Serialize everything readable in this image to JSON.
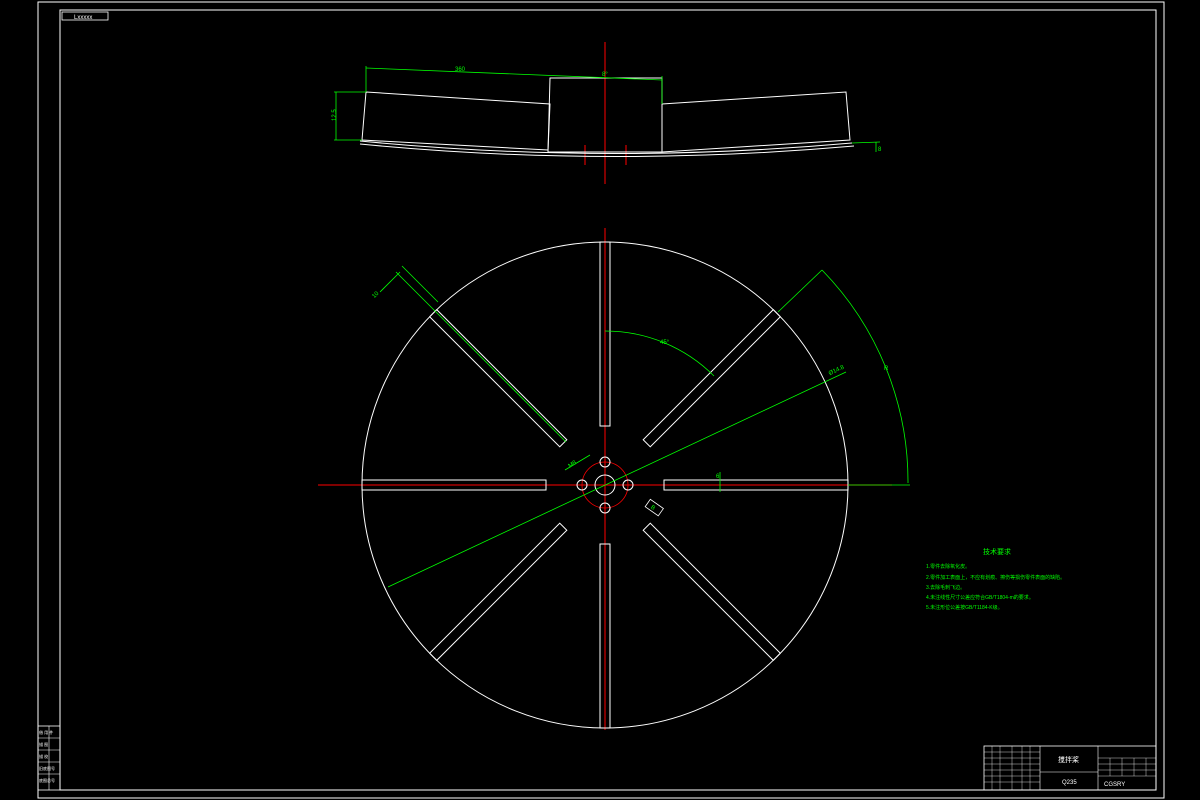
{
  "drawing": {
    "corner_label": "Lxxxxx",
    "colors": {
      "background": "#000000",
      "outline": "#ffffff",
      "dimension": "#00ff00",
      "centerline": "#ff0000"
    }
  },
  "elevation_view": {
    "dims": {
      "length": "360",
      "height": "12.5",
      "angle": "8°",
      "thickness": "8"
    }
  },
  "plan_view": {
    "dims": {
      "angle": "45°",
      "hole_dia": "Ø14.8",
      "radius": "R",
      "blade_width": "10",
      "center_dim": "6",
      "hub_dim": "M8",
      "slot_label": "B"
    }
  },
  "technical_requirements": {
    "title": "技术要求",
    "items": [
      "1.零件去除氧化皮。",
      "2.零件加工表面上，不应有划痕、擦伤等损伤零件表面的缺陷。",
      "3.去除毛刺飞边。",
      "4.未注线性尺寸公差应符合GB/T1804-m的要求。",
      "5.未注形位公差按GB/T1184-K级。"
    ]
  },
  "title_block": {
    "part_name": "搅拌桨",
    "drawing_number": "CGSRY",
    "material": "Q235"
  },
  "left_side_table": {
    "rows": [
      "借 用 件",
      "描 图",
      "描 校",
      "旧底图号",
      "底图总号"
    ]
  }
}
